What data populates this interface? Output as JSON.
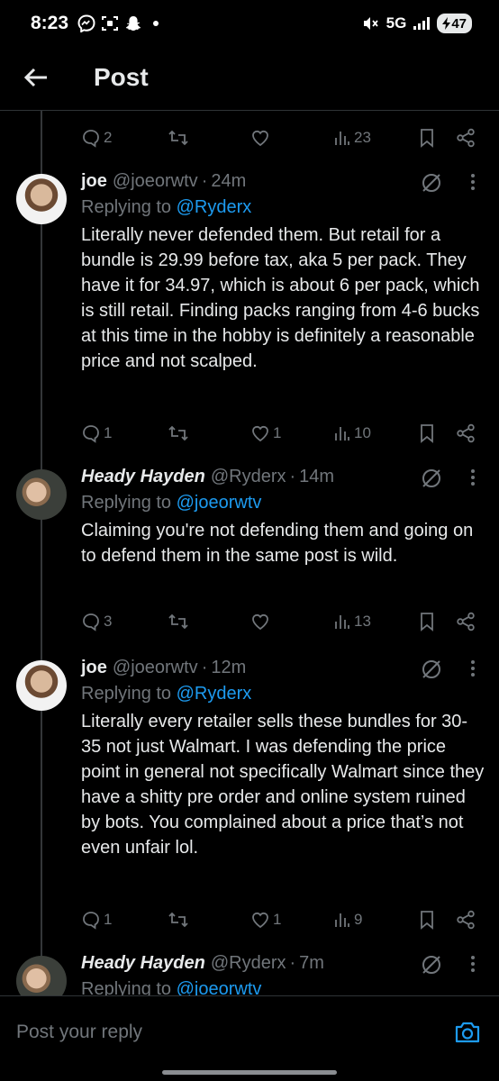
{
  "status_bar": {
    "time": "8:23",
    "network": "5G",
    "battery": "47"
  },
  "header": {
    "title": "Post"
  },
  "reply_bar": {
    "placeholder": "Post your reply"
  },
  "colors": {
    "background": "#000000",
    "text": "#e7e9ea",
    "muted": "#71767b",
    "accent": "#1d9bf0",
    "divider": "#2f3336"
  },
  "top_actions": {
    "replies": "2",
    "reposts": "",
    "likes": "",
    "views": "23"
  },
  "tweets": [
    {
      "name": "joe",
      "handle": "@joeorwtv",
      "time": "24m",
      "replying_label": "Replying to",
      "replying_to": "@Ryderx",
      "text": "Literally never defended them. But retail for a bundle is 29.99 before tax, aka 5 per pack. They have it for 34.97, which is about 6 per pack, which is still retail. Finding packs ranging from 4-6 bucks at this time in the hobby is definitely a reasonable price and not scalped.",
      "replies": "1",
      "reposts": "",
      "likes": "1",
      "views": "10"
    },
    {
      "name": "Heady Hayden",
      "handle": "@Ryderx",
      "time": "14m",
      "replying_label": "Replying to",
      "replying_to": "@joeorwtv",
      "text": "Claiming you're not defending them and going on to defend them in the same post is wild.",
      "replies": "3",
      "reposts": "",
      "likes": "",
      "views": "13"
    },
    {
      "name": "joe",
      "handle": "@joeorwtv",
      "time": "12m",
      "replying_label": "Replying to",
      "replying_to": "@Ryderx",
      "text": "Literally every retailer sells these bundles for 30-35 not just Walmart. I was defending the price point in general not specifically Walmart since they have a shitty pre order and online system ruined by bots. You complained about a price that’s not even unfair lol.",
      "replies": "1",
      "reposts": "",
      "likes": "1",
      "views": "9"
    },
    {
      "name": "Heady Hayden",
      "handle": "@Ryderx",
      "time": "7m",
      "replying_label": "Replying to",
      "replying_to": "@joeorwtv",
      "text": ""
    }
  ]
}
